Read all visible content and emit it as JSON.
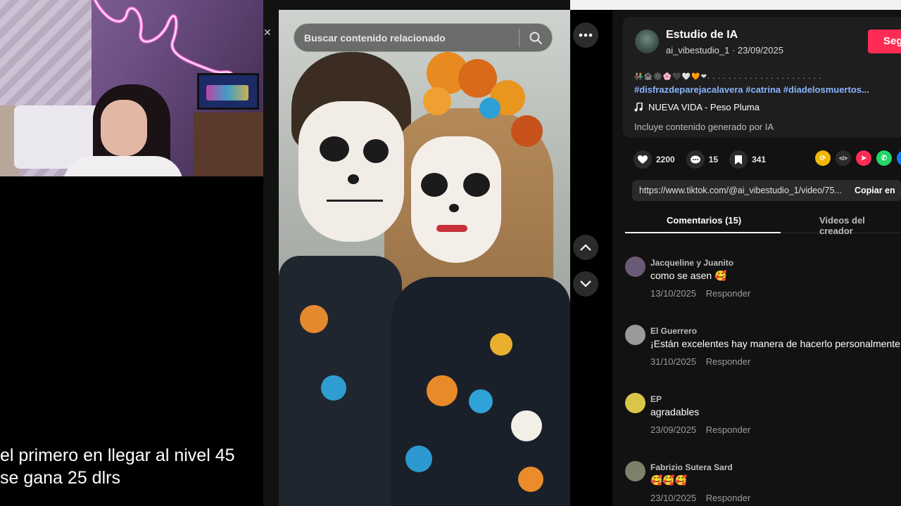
{
  "overlay": {
    "subtitle_line1": "el primero en llegar al nivel 45",
    "subtitle_line2": "se gana 25 dlrs"
  },
  "video": {
    "search_placeholder": "Buscar contenido relacionado",
    "close_symbol": "✕"
  },
  "post": {
    "creator_name": "Estudio de IA",
    "creator_meta": "ai_vibestudio_1 · 23/09/2025",
    "follow_label": "Seg",
    "emoji_line": "👫🏚⚙🌸🖤🤍🧡❤. . . . . . . . . . . . . . . . . . . . . .",
    "hashtags": "#disfrazdeparejacalavera #catrina #díadelosmuertos...",
    "music_label": "NUEVA VIDA - Peso Pluma",
    "ai_note": "Incluye contenido generado por IA"
  },
  "stats": {
    "likes": "2200",
    "comments": "15",
    "saves": "341"
  },
  "share_icons": [
    {
      "name": "repost-icon",
      "color": "#f2b705",
      "glyph": "⟳"
    },
    {
      "name": "embed-icon",
      "color": "#2b2b2b",
      "glyph": "</>"
    },
    {
      "name": "send-icon",
      "color": "#fe2c55",
      "glyph": "➤"
    },
    {
      "name": "whatsapp-icon",
      "color": "#25d366",
      "glyph": "✆"
    },
    {
      "name": "facebook-icon",
      "color": "#1877f2",
      "glyph": "f"
    }
  ],
  "link": {
    "url": "https://www.tiktok.com/@ai_vibestudio_1/video/75...",
    "copy_label": "Copiar en"
  },
  "tabs": {
    "comments_label": "Comentarios (15)",
    "creator_videos_label": "Videos del creador"
  },
  "comments": [
    {
      "user": "Jacqueline y Juanito",
      "text": "como se asen 🥰",
      "date": "13/10/2025",
      "reply": "Responder",
      "avatar_color": "#6b5a76"
    },
    {
      "user": "El Guerrero",
      "text": "¡Están excelentes hay manera de hacerlo personalmente!",
      "date": "31/10/2025",
      "reply": "Responder",
      "avatar_color": "#9a9a9a"
    },
    {
      "user": "EP",
      "text": "agradables",
      "date": "23/09/2025",
      "reply": "Responder",
      "avatar_color": "#d7c64a"
    },
    {
      "user": "Fabrizio Sutera Sard",
      "text": "🥰🥰🥰",
      "date": "23/10/2025",
      "reply": "Responder",
      "avatar_color": "#7e806a"
    }
  ]
}
